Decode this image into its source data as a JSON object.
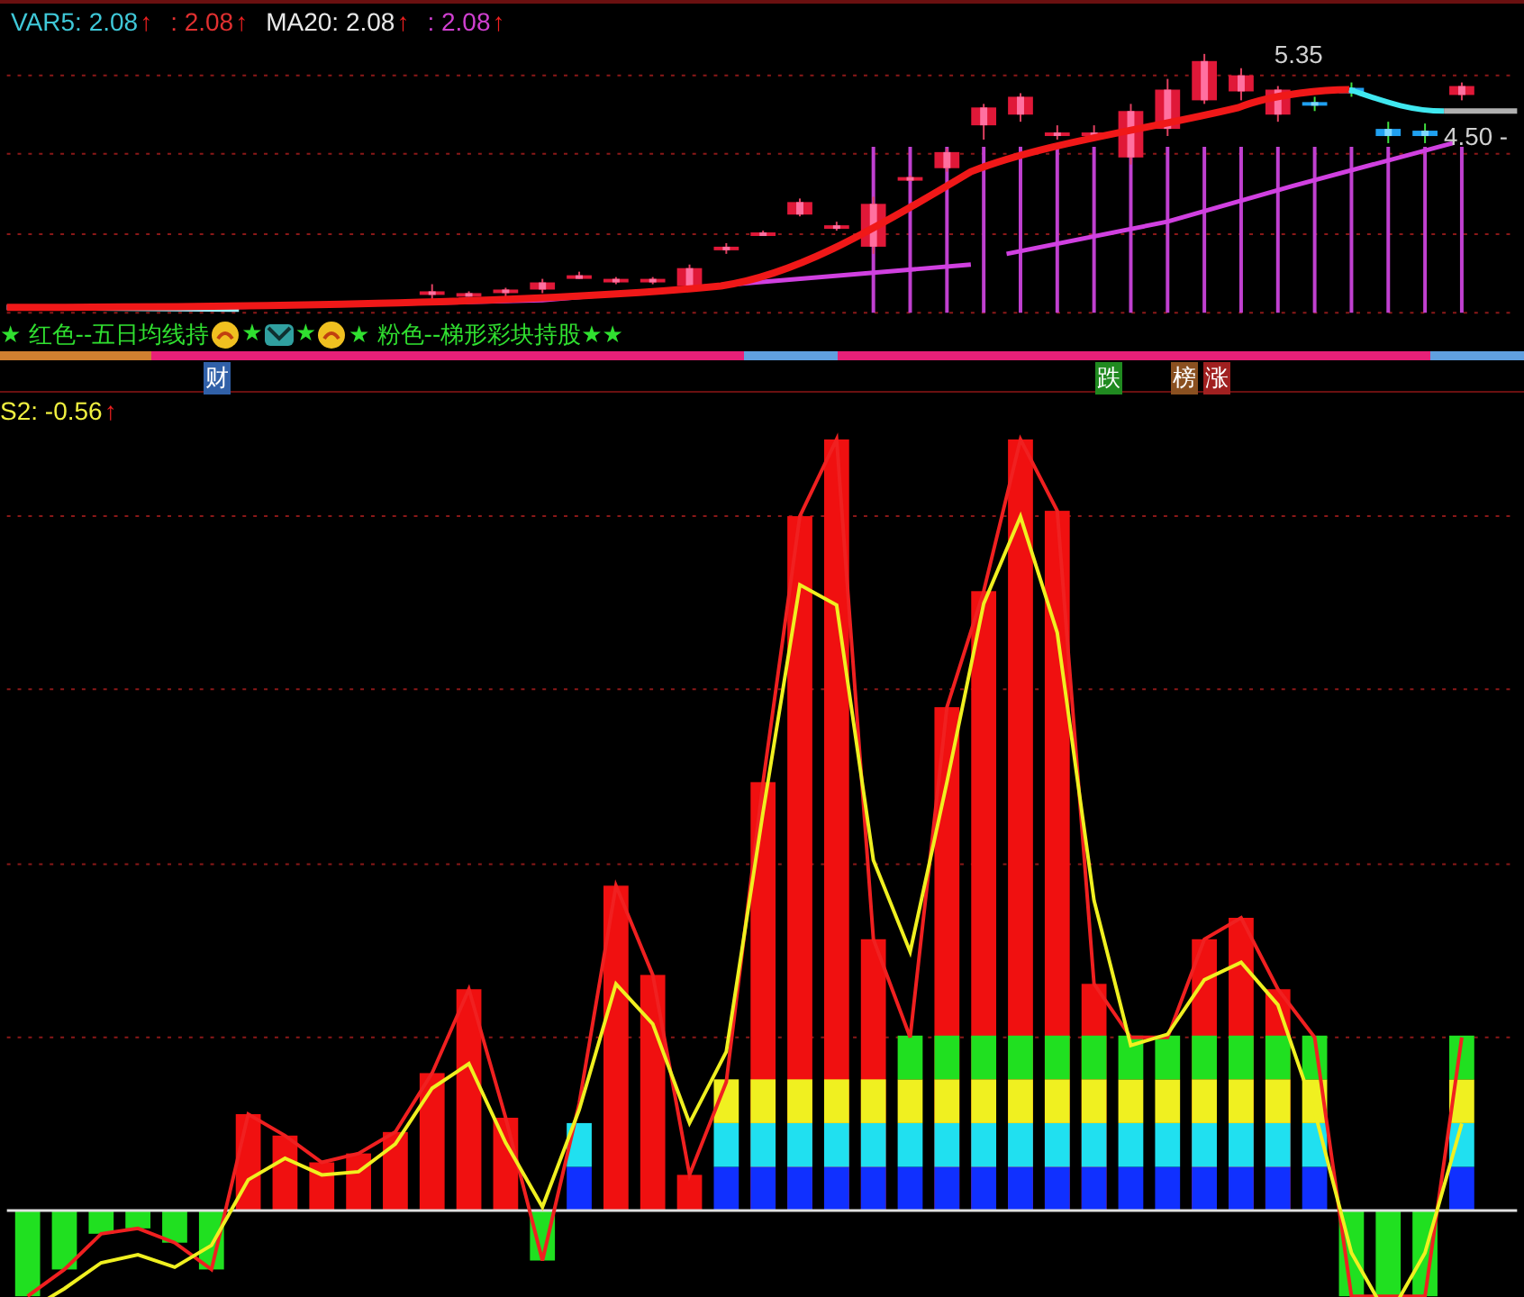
{
  "legend": [
    {
      "label": "VAR5: 2.08",
      "arrow": "↑",
      "color": "#3fc8d8"
    },
    {
      "label": ": 2.08",
      "arrow": "↑",
      "color": "#e03030"
    },
    {
      "label": "MA20: 2.08",
      "arrow": "↑",
      "color": "#e8e8e8"
    },
    {
      "label": ": 2.08",
      "arrow": "↑",
      "color": "#d040d0"
    }
  ],
  "price_high": "5.35",
  "price_low": "4.50 -",
  "signal_row": [
    {
      "kind": "text",
      "text": "★ 红色--五日均线持"
    },
    {
      "kind": "smiley"
    },
    {
      "kind": "text",
      "text": "★"
    },
    {
      "kind": "mail"
    },
    {
      "kind": "text",
      "text": "★"
    },
    {
      "kind": "smiley"
    },
    {
      "kind": "text",
      "text": "★ 粉色--梯形彩块持股★★"
    }
  ],
  "markers": [
    {
      "label": "财",
      "color": "#3060a8"
    },
    {
      "label": "跌",
      "color": "#208a20"
    },
    {
      "label": "榜",
      "color": "#8a5020"
    },
    {
      "label": "涨",
      "color": "#a02020"
    }
  ],
  "indicator": {
    "label": "S2: -0.56",
    "arrow": "↑"
  }
}
